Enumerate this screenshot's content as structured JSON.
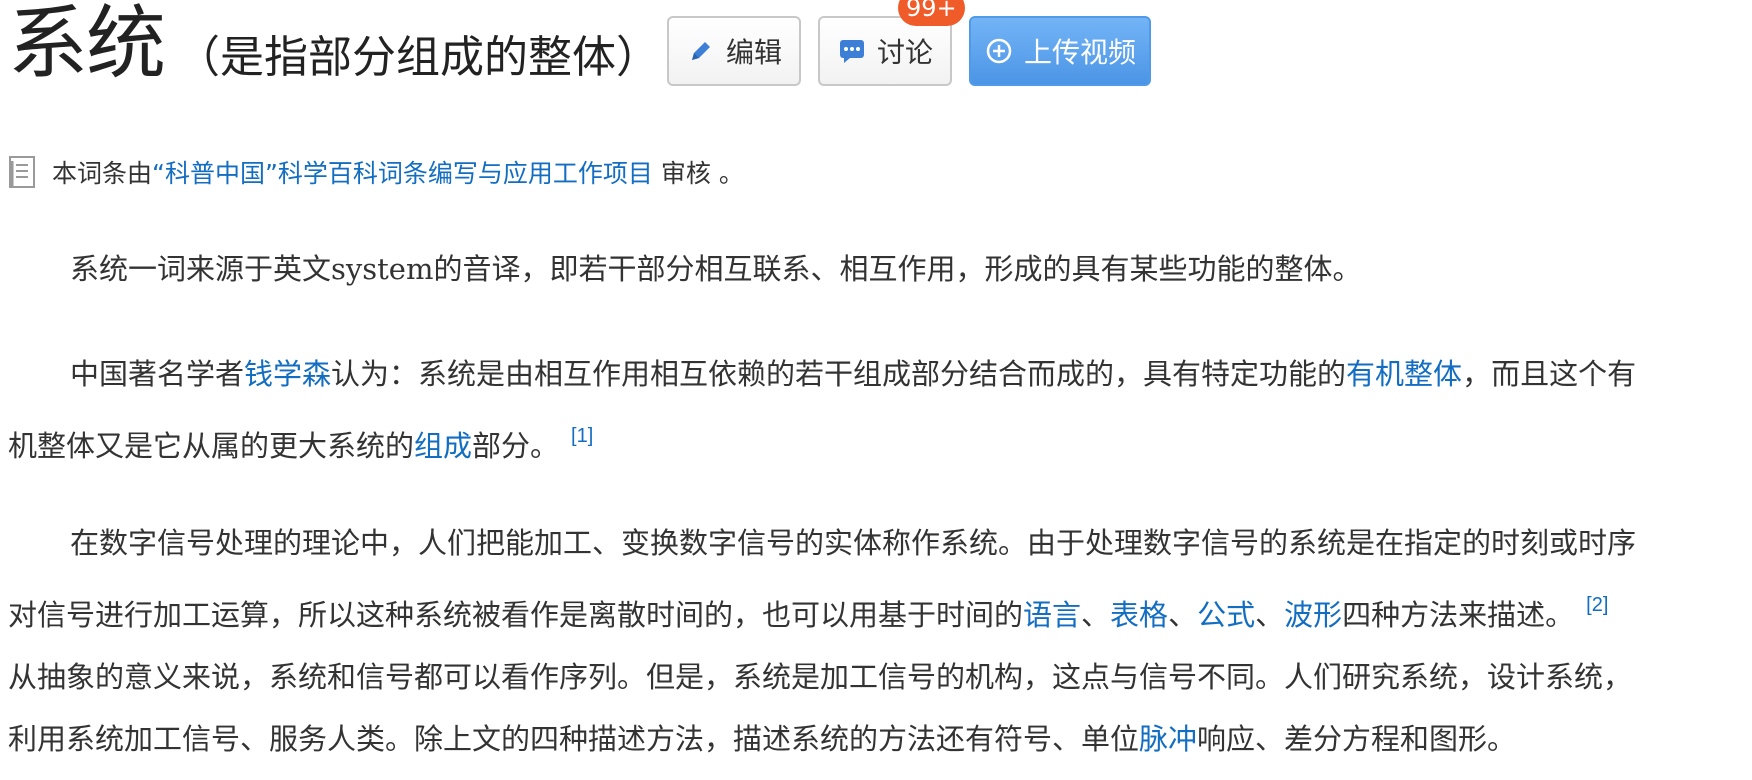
{
  "header": {
    "title": "系统",
    "subtitle": "（是指部分组成的整体）",
    "buttons": {
      "edit": "编辑",
      "discuss": "讨论",
      "upload": "上传视频"
    },
    "discuss_badge": "99+",
    "accent_color": "#4c95e6",
    "badge_color": "#f05b2a"
  },
  "review": {
    "prefix": "本词条由",
    "link": "“科普中国”科学百科词条编写与应用工作项目",
    "suffix": "审核 。"
  },
  "paragraphs": {
    "p1": {
      "line1": "系统一词来源于英文system的音译，即若干部分相互联系、相互作用，形成的具有某些功能的整体。"
    },
    "p2": {
      "l1_a": "中国著名学者",
      "l1_link1": "钱学森",
      "l1_b": "认为：系统是由相互作用相互依赖的若干组成部分结合而成的，具有特定功能的",
      "l1_link2": "有机整体",
      "l1_c": "，而且这个有",
      "l2_a": "机整体又是它从属的更大系统的",
      "l2_link": "组成",
      "l2_b": "部分。",
      "ref": "[1]"
    },
    "p3": {
      "l1": "在数字信号处理的理论中，人们把能加工、变换数字信号的实体称作系统。由于处理数字信号的系统是在指定的时刻或时序",
      "l2_a": "对信号进行加工运算，所以这种系统被看作是离散时间的，也可以用基于时间的",
      "l2_link1": "语言",
      "l2_sep1": "、",
      "l2_link2": "表格",
      "l2_sep2": "、",
      "l2_link3": "公式",
      "l2_sep3": "、",
      "l2_link4": "波形",
      "l2_b": "四种方法来描述。",
      "ref": "[2]",
      "l3": "从抽象的意义来说，系统和信号都可以看作序列。但是，系统是加工信号的机构，这点与信号不同。人们研究系统，设计系统，",
      "l4_a": "利用系统加工信号、服务人类。除上文的四种描述方法，描述系统的方法还有符号、单位",
      "l4_link": "脉冲",
      "l4_b": "响应、差分方程和图形。"
    }
  }
}
